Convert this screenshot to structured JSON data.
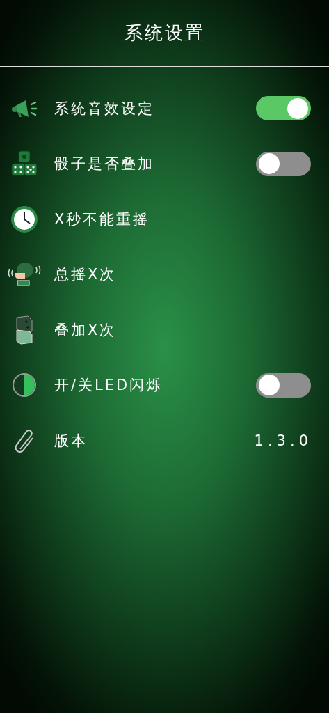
{
  "title": "系统设置",
  "settings": [
    {
      "kind": "switch",
      "label": "系统音效设定",
      "on": true
    },
    {
      "kind": "switch",
      "label": "骰子是否叠加",
      "on": false
    },
    {
      "kind": "plain",
      "label": "X秒不能重摇"
    },
    {
      "kind": "plain",
      "label": "总摇X次"
    },
    {
      "kind": "plain",
      "label": "叠加X次"
    },
    {
      "kind": "switch",
      "label": "开/关LED闪烁",
      "on": false
    },
    {
      "kind": "value",
      "label": "版本",
      "value": "1.3.0"
    }
  ]
}
